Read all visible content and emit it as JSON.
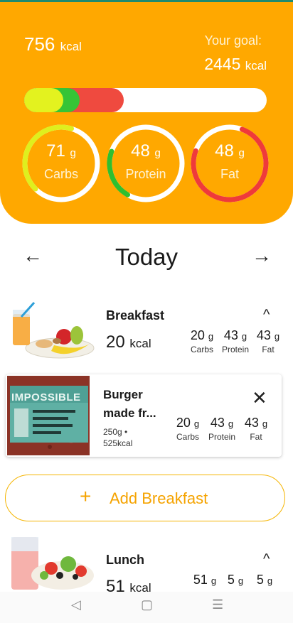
{
  "summary": {
    "kcal_value": "756",
    "kcal_unit": "kcal",
    "goal_label": "Your goal:",
    "goal_value": "2445",
    "goal_unit": "kcal",
    "progress_fractions": {
      "carbs": 0.11,
      "protein": 0.07,
      "fat": 0.18
    },
    "macros": [
      {
        "value": "71",
        "unit": "g",
        "label": "Carbs",
        "color": "#dfef1e",
        "fraction": 0.42
      },
      {
        "value": "48",
        "unit": "g",
        "label": "Protein",
        "color": "#2fbf2f",
        "fraction": 0.22
      },
      {
        "value": "48",
        "unit": "g",
        "label": "Fat",
        "color": "#ef3a3a",
        "fraction": 0.75
      }
    ]
  },
  "day_nav": {
    "title": "Today",
    "prev_icon": "←",
    "next_icon": "→"
  },
  "breakfast": {
    "title": "Breakfast",
    "kcal_value": "20",
    "kcal_unit": "kcal",
    "chevron": "^",
    "macros": [
      {
        "value": "20",
        "unit": "g",
        "label": "Carbs"
      },
      {
        "value": "43",
        "unit": "g",
        "label": "Protein"
      },
      {
        "value": "43",
        "unit": "g",
        "label": "Fat"
      }
    ],
    "food_item": {
      "name": "Burger made fr...",
      "brand_text": "IMPOSSIBLE",
      "weight": "250g •",
      "kcal": "525kcal",
      "close_icon": "✕",
      "macros": [
        {
          "value": "20",
          "unit": "g",
          "label": "Carbs"
        },
        {
          "value": "43",
          "unit": "g",
          "label": "Protein"
        },
        {
          "value": "43",
          "unit": "g",
          "label": "Fat"
        }
      ]
    },
    "add_button": {
      "plus": "+",
      "label": "Add Breakfast"
    }
  },
  "lunch": {
    "title": "Lunch",
    "kcal_value": "51",
    "kcal_unit": "kcal",
    "chevron": "^",
    "macros": [
      {
        "value": "51",
        "unit": "g"
      },
      {
        "value": "5",
        "unit": "g"
      },
      {
        "value": "5",
        "unit": "g"
      }
    ]
  },
  "system_nav": {
    "back": "◁",
    "home": "▢",
    "menu": "☰"
  },
  "colors": {
    "header": "#ffa800",
    "accent": "#f5a300",
    "carbs": "#dfef1e",
    "protein": "#2fbf2f",
    "fat": "#ef3a3a"
  }
}
